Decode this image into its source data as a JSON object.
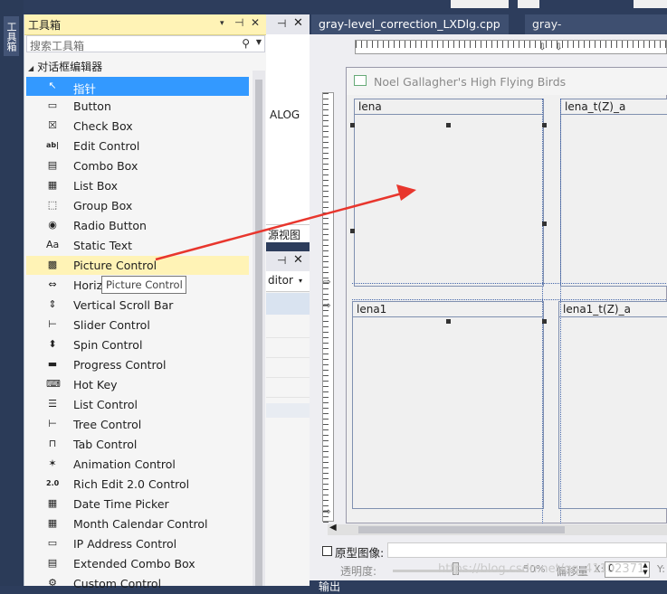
{
  "vertical_tab": {
    "label": "工具箱"
  },
  "toolbox": {
    "title": "工具箱",
    "title_buttons": [
      "▾",
      "⊣",
      "✕"
    ],
    "search_placeholder": "搜索工具箱",
    "group_label": "对话框编辑器",
    "items": [
      {
        "label": "指针",
        "icon": "pointer-icon",
        "glyph": "↖"
      },
      {
        "label": "Button",
        "icon": "button-icon",
        "glyph": "▭"
      },
      {
        "label": "Check Box",
        "icon": "check-box-icon",
        "glyph": "☒"
      },
      {
        "label": "Edit Control",
        "icon": "edit-control-icon",
        "glyph": "ab|"
      },
      {
        "label": "Combo Box",
        "icon": "combo-box-icon",
        "glyph": "▤"
      },
      {
        "label": "List Box",
        "icon": "list-box-icon",
        "glyph": "▦"
      },
      {
        "label": "Group Box",
        "icon": "group-box-icon",
        "glyph": "⬚"
      },
      {
        "label": "Radio Button",
        "icon": "radio-button-icon",
        "glyph": "◉"
      },
      {
        "label": "Static Text",
        "icon": "static-text-icon",
        "glyph": "Aa"
      },
      {
        "label": "Picture Control",
        "icon": "picture-control-icon",
        "glyph": "▩"
      },
      {
        "label": "Horiz",
        "icon": "horizontal-scroll-bar-icon",
        "glyph": "⇔"
      },
      {
        "label": "Vertical Scroll Bar",
        "icon": "vertical-scroll-bar-icon",
        "glyph": "⇕"
      },
      {
        "label": "Slider Control",
        "icon": "slider-control-icon",
        "glyph": "⊢"
      },
      {
        "label": "Spin Control",
        "icon": "spin-control-icon",
        "glyph": "⬍"
      },
      {
        "label": "Progress Control",
        "icon": "progress-control-icon",
        "glyph": "▬"
      },
      {
        "label": "Hot Key",
        "icon": "hot-key-icon",
        "glyph": "⌨"
      },
      {
        "label": "List Control",
        "icon": "list-control-icon",
        "glyph": "☰"
      },
      {
        "label": "Tree Control",
        "icon": "tree-control-icon",
        "glyph": "⊢"
      },
      {
        "label": "Tab Control",
        "icon": "tab-control-icon",
        "glyph": "⊓"
      },
      {
        "label": "Animation Control",
        "icon": "animation-control-icon",
        "glyph": "✶"
      },
      {
        "label": "Rich Edit 2.0 Control",
        "icon": "rich-edit-icon",
        "glyph": "2.0"
      },
      {
        "label": "Date Time Picker",
        "icon": "date-time-picker-icon",
        "glyph": "▦"
      },
      {
        "label": "Month Calendar Control",
        "icon": "month-calendar-icon",
        "glyph": "▦"
      },
      {
        "label": "IP Address Control",
        "icon": "ip-address-icon",
        "glyph": "▭"
      },
      {
        "label": "Extended Combo Box",
        "icon": "extended-combo-box-icon",
        "glyph": "▤"
      },
      {
        "label": "Custom Control",
        "icon": "custom-control-icon",
        "glyph": "⚙"
      }
    ],
    "tooltip": "Picture Control"
  },
  "middle": {
    "alog_text": "ALOG",
    "resource_view": "源视图",
    "editor_text": "ditor",
    "editor_dd": "▾",
    "pin": "⊣",
    "close": "✕"
  },
  "tabs": {
    "tab1": "gray-level_correction_LXDlg.cpp",
    "tab2": "gray-level_corre...X_DIALOG"
  },
  "dialog": {
    "title": "Noel Gallagher's High Flying Birds",
    "pictures": [
      "lena",
      "lena_t(Z)_a",
      "lena1",
      "lena1_t(Z)_a"
    ]
  },
  "bottom": {
    "checkbox_label": "原型图像:",
    "opacity_label": "透明度:",
    "opacity_value": "50%",
    "offset_label": "偏移量",
    "offset_x_label": "X:",
    "offset_x_value": "0",
    "offset_y_label": "Y:",
    "output_label": "输出"
  },
  "watermark": "https://blog.csdn.net/qq_41102371",
  "colors": {
    "selection": "#3399ff",
    "hover": "#fff3b6",
    "arrow": "#e8362d",
    "chrome": "#2d3d5c"
  }
}
